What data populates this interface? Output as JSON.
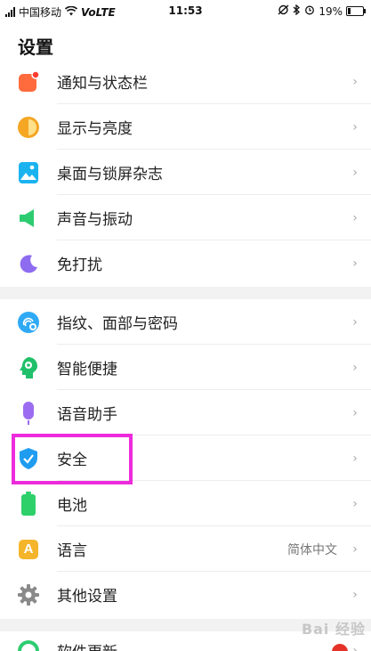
{
  "status_bar": {
    "carrier": "中国移动",
    "network": "VoLTE",
    "time": "11:53",
    "battery": "19%"
  },
  "page": {
    "title": "设置"
  },
  "group1": [
    {
      "label": "通知与状态栏",
      "icon": "notification-icon",
      "color": "#ff6b3d"
    },
    {
      "label": "显示与亮度",
      "icon": "display-brightness-icon",
      "color": "#f5a623"
    },
    {
      "label": "桌面与锁屏杂志",
      "icon": "wallpaper-icon",
      "color": "#1ab3f0"
    },
    {
      "label": "声音与振动",
      "icon": "speaker-icon",
      "color": "#2ecc71"
    },
    {
      "label": "免打扰",
      "icon": "moon-icon",
      "color": "#8e6cf0"
    }
  ],
  "group2": [
    {
      "label": "指纹、面部与密码",
      "icon": "fingerprint-face-icon",
      "color": "#2eaaf5"
    },
    {
      "label": "智能便捷",
      "icon": "smart-head-icon",
      "color": "#20c06a"
    },
    {
      "label": "语音助手",
      "icon": "microphone-icon",
      "color": "#9b6cf0"
    },
    {
      "label": "安全",
      "icon": "shield-icon",
      "color": "#1e9cf0"
    },
    {
      "label": "电池",
      "icon": "battery-icon",
      "color": "#2ed06a"
    },
    {
      "label": "语言",
      "icon": "language-icon",
      "color": "#f5b52a",
      "value": "简体中文",
      "icon_text": "A"
    },
    {
      "label": "其他设置",
      "icon": "gear-icon",
      "color": "#8a8a8a"
    }
  ],
  "group3": [
    {
      "label": "软件更新",
      "icon": "update-icon",
      "color": "#2ecc71"
    }
  ],
  "chevron": "›",
  "watermark": "Bai 经验"
}
